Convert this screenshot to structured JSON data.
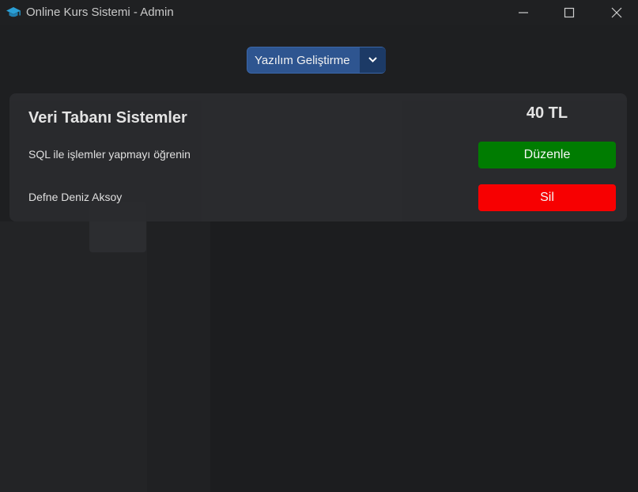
{
  "window": {
    "title": "Online Kurs Sistemi - Admin",
    "controls": [
      "minimize",
      "maximize",
      "close"
    ]
  },
  "category_dropdown": {
    "selected": "Yazılım Geliştirme"
  },
  "course": {
    "title": "Veri Tabanı Sistemler",
    "price": "40 TL",
    "description": "SQL ile işlemler yapmayı öğrenin",
    "instructor": "Defne Deniz Aksoy",
    "edit_label": "Düzenle",
    "delete_label": "Sil"
  },
  "colors": {
    "dropdown_bg": "#2e5590",
    "edit_button": "#008000",
    "delete_button": "#ff0000",
    "card_bg": "#2a2b2e",
    "window_bg": "#1e1f21"
  }
}
